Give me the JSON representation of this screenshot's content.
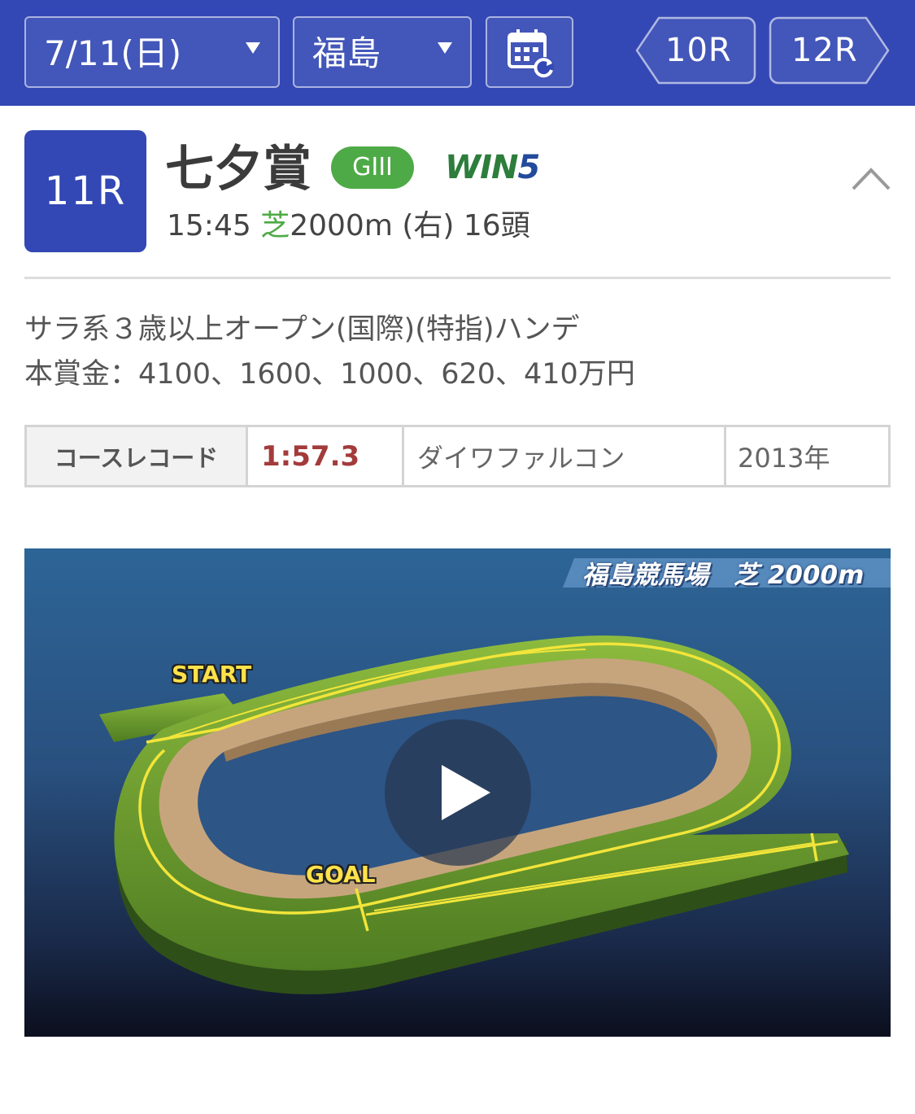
{
  "header": {
    "date_selector": "7/11(日)",
    "venue_selector": "福島",
    "prev_race": "10R",
    "next_race": "12R",
    "calendar_icon": "calendar-refresh-icon"
  },
  "race": {
    "number": "11R",
    "name": "七夕賞",
    "grade": "GIII",
    "win5_logo_main": "WIN",
    "win5_logo_num": "5",
    "start_time": "15:45",
    "surface": "芝",
    "distance_direction": "2000m (右)",
    "runners": "16頭",
    "conditions": "サラ系３歳以上オープン(国際)(特指)ハンデ",
    "prize_money": "本賞金：4100、1600、1000、620、410万円"
  },
  "course_record": {
    "label": "コースレコード",
    "time": "1:57.3",
    "horse": "ダイワファルコン",
    "year": "2013年"
  },
  "course_video": {
    "title": "福島競馬場　芝 2000m",
    "start_label": "START",
    "goal_label": "GOAL"
  },
  "colors": {
    "brand_blue": "#3348b4",
    "grade_green": "#4eaa46",
    "record_red": "#a33b3b"
  }
}
